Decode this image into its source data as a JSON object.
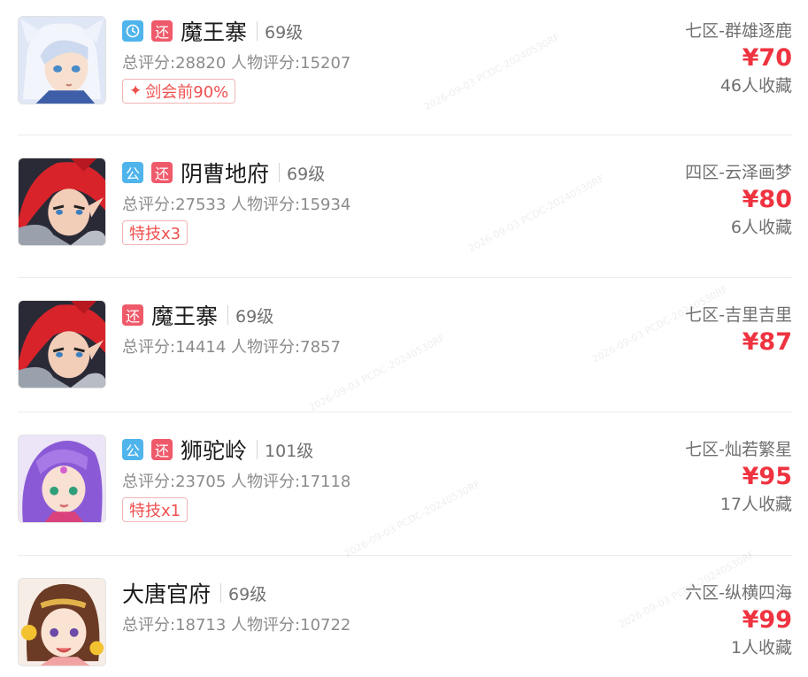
{
  "listings": [
    {
      "tags": [
        "clock",
        "还"
      ],
      "school": "魔王寨",
      "level": "69级",
      "scores": "总评分:28820 人物评分:15207",
      "badge": "剑会前90%",
      "server": "七区-群雄逐鹿",
      "price": "¥70",
      "favorites": "46人收藏"
    },
    {
      "tags": [
        "公",
        "还"
      ],
      "school": "阴曹地府",
      "level": "69级",
      "scores": "总评分:27533 人物评分:15934",
      "badge": "特技x3",
      "server": "四区-云泽画梦",
      "price": "¥80",
      "favorites": "6人收藏"
    },
    {
      "tags": [
        "还"
      ],
      "school": "魔王寨",
      "level": "69级",
      "scores": "总评分:14414 人物评分:7857",
      "server": "七区-吉里吉里",
      "price": "¥87"
    },
    {
      "tags": [
        "公",
        "还"
      ],
      "school": "狮驼岭",
      "level": "101级",
      "scores": "总评分:23705 人物评分:17118",
      "badge": "特技x1",
      "server": "七区-灿若繁星",
      "price": "¥95",
      "favorites": "17人收藏"
    },
    {
      "tags": [],
      "school": "大唐官府",
      "level": "69级",
      "scores": "总评分:18713 人物评分:10722",
      "server": "六区-纵横四海",
      "price": "¥99",
      "favorites": "1人收藏"
    }
  ],
  "watermark": "2026-09-03 PCDC-20240530RF",
  "colors": {
    "price": "#ef3340",
    "tag_blue": "#4fb4ec",
    "tag_red": "#ef5a6b",
    "badge_red": "#ef4f4f"
  }
}
